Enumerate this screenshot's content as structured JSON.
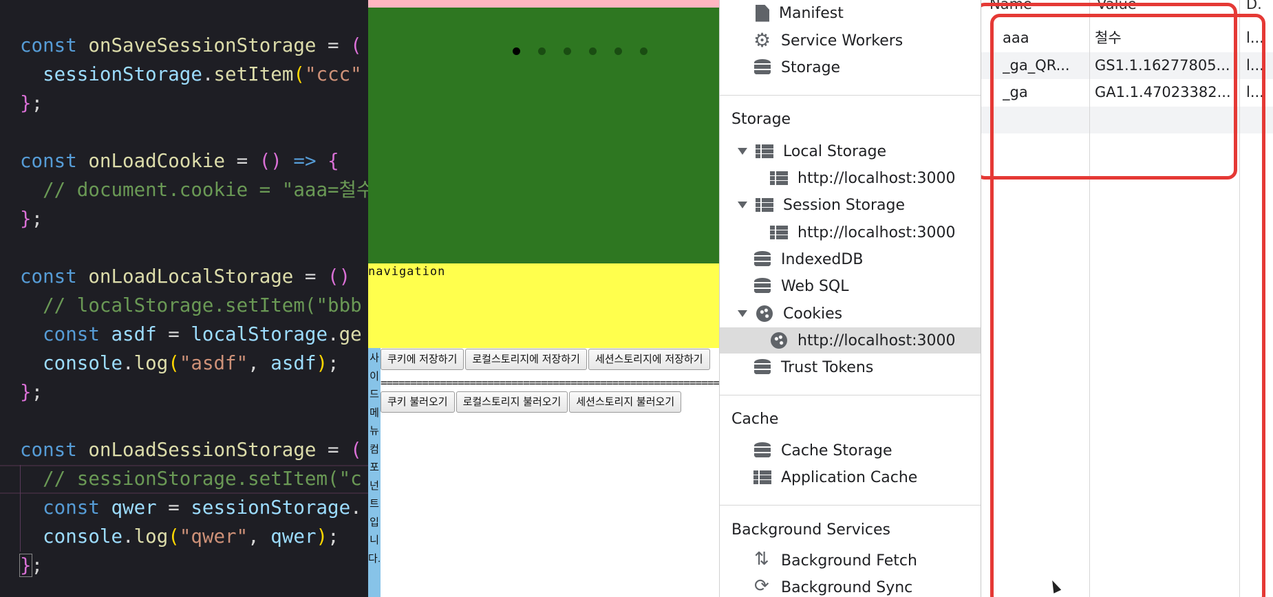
{
  "editor": {
    "lines": [
      [
        [
          "kw",
          "const "
        ],
        [
          "fn",
          "onSaveSessionStorage"
        ],
        [
          "pun",
          " = "
        ],
        [
          "brk",
          "("
        ]
      ],
      [
        [
          "pun",
          "  "
        ],
        [
          "var",
          "sessionStorage"
        ],
        [
          "pun",
          "."
        ],
        [
          "fn",
          "setItem"
        ],
        [
          "br2",
          "("
        ],
        [
          "str",
          "\"ccc\""
        ]
      ],
      [
        [
          "brk",
          "}"
        ],
        [
          "pun",
          ";"
        ]
      ],
      [
        [
          "pun",
          ""
        ]
      ],
      [
        [
          "kw",
          "const "
        ],
        [
          "fn",
          "onLoadCookie"
        ],
        [
          "pun",
          " = "
        ],
        [
          "brk",
          "()"
        ],
        [
          "kw",
          " => "
        ],
        [
          "brk",
          "{"
        ]
      ],
      [
        [
          "cmt",
          "  // document.cookie = \"aaa=철수"
        ]
      ],
      [
        [
          "brk",
          "}"
        ],
        [
          "pun",
          ";"
        ]
      ],
      [
        [
          "pun",
          ""
        ]
      ],
      [
        [
          "kw",
          "const "
        ],
        [
          "fn",
          "onLoadLocalStorage"
        ],
        [
          "pun",
          " = "
        ],
        [
          "brk",
          "()"
        ]
      ],
      [
        [
          "cmt",
          "  // localStorage.setItem(\"bbb"
        ]
      ],
      [
        [
          "kw",
          "  const "
        ],
        [
          "var",
          "asdf"
        ],
        [
          "pun",
          " = "
        ],
        [
          "var",
          "localStorage"
        ],
        [
          "pun",
          "."
        ],
        [
          "fn",
          "ge"
        ]
      ],
      [
        [
          "pun",
          "  "
        ],
        [
          "var",
          "console"
        ],
        [
          "pun",
          "."
        ],
        [
          "fn",
          "log"
        ],
        [
          "br2",
          "("
        ],
        [
          "str",
          "\"asdf\""
        ],
        [
          "pun",
          ", "
        ],
        [
          "var",
          "asdf"
        ],
        [
          "br2",
          ")"
        ],
        [
          "pun",
          ";"
        ]
      ],
      [
        [
          "brk",
          "}"
        ],
        [
          "pun",
          ";"
        ]
      ],
      [
        [
          "pun",
          ""
        ]
      ],
      [
        [
          "kw",
          "const "
        ],
        [
          "fn",
          "onLoadSessionStorage"
        ],
        [
          "pun",
          " = "
        ],
        [
          "brk",
          "("
        ]
      ],
      [
        [
          "cmt",
          "  // sessionStorage.setItem(\"c"
        ]
      ],
      [
        [
          "kw",
          "  const "
        ],
        [
          "var",
          "qwer"
        ],
        [
          "pun",
          " = "
        ],
        [
          "var",
          "sessionStorage"
        ],
        [
          "pun",
          "."
        ]
      ],
      [
        [
          "pun",
          "  "
        ],
        [
          "var",
          "console"
        ],
        [
          "pun",
          "."
        ],
        [
          "fn",
          "log"
        ],
        [
          "br2",
          "("
        ],
        [
          "str",
          "\"qwer\""
        ],
        [
          "pun",
          ", "
        ],
        [
          "var",
          "qwer"
        ],
        [
          "br2",
          ")"
        ],
        [
          "pun",
          ";"
        ]
      ],
      [
        [
          "brk",
          "}"
        ],
        [
          "pun",
          ";"
        ]
      ]
    ]
  },
  "page": {
    "nav_label": "navigation",
    "side_menu_text": [
      "사",
      "이",
      "드",
      "메",
      "뉴",
      "컴",
      "포",
      "넌",
      "트",
      "입",
      "니",
      "다."
    ],
    "save_buttons": [
      "쿠키에 저장하기",
      "로컬스토리지에 저장하기",
      "세션스토리지에 저장하기"
    ],
    "separator": "=======================================================================",
    "load_buttons": [
      "쿠키 불러오기",
      "로컬스토리지 불러오기",
      "세션스토리지 불러오기"
    ],
    "carousel_dots": 6,
    "active_dot": 0
  },
  "devtools": {
    "top_items": [
      {
        "label": "Manifest",
        "icon": "file-icon"
      },
      {
        "label": "Service Workers",
        "icon": "gear-icon"
      },
      {
        "label": "Storage",
        "icon": "database-icon"
      }
    ],
    "storage_header": "Storage",
    "storage_items": [
      {
        "label": "Local Storage",
        "icon": "grid-icon",
        "expandable": true
      },
      {
        "label": "http://localhost:3000",
        "icon": "grid-icon",
        "child": true
      },
      {
        "label": "Session Storage",
        "icon": "grid-icon",
        "expandable": true
      },
      {
        "label": "http://localhost:3000",
        "icon": "grid-icon",
        "child": true
      },
      {
        "label": "IndexedDB",
        "icon": "database-icon"
      },
      {
        "label": "Web SQL",
        "icon": "database-icon"
      },
      {
        "label": "Cookies",
        "icon": "cookie-icon",
        "expandable": true
      },
      {
        "label": "http://localhost:3000",
        "icon": "cookie-icon",
        "child": true,
        "selected": true
      },
      {
        "label": "Trust Tokens",
        "icon": "database-icon"
      }
    ],
    "cache_header": "Cache",
    "cache_items": [
      {
        "label": "Cache Storage",
        "icon": "database-icon"
      },
      {
        "label": "Application Cache",
        "icon": "grid-icon"
      }
    ],
    "bg_header": "Background Services",
    "bg_items": [
      {
        "label": "Background Fetch",
        "icon": "fetch-icon"
      },
      {
        "label": "Background Sync",
        "icon": "sync-icon"
      }
    ]
  },
  "cookie_table": {
    "headers": [
      "Name",
      "Value",
      "D."
    ],
    "rows": [
      [
        "aaa",
        "철수",
        "l..."
      ],
      [
        "_ga_QR...",
        "GS1.1.16277805...",
        "l..."
      ],
      [
        "_ga",
        "GA1.1.47023382...",
        "l..."
      ]
    ]
  },
  "colors": {
    "annotation_red": "#e53935",
    "carousel_green": "#2e7721",
    "nav_yellow": "#ffff4d",
    "sidemenu_blue": "#87c3e8"
  }
}
